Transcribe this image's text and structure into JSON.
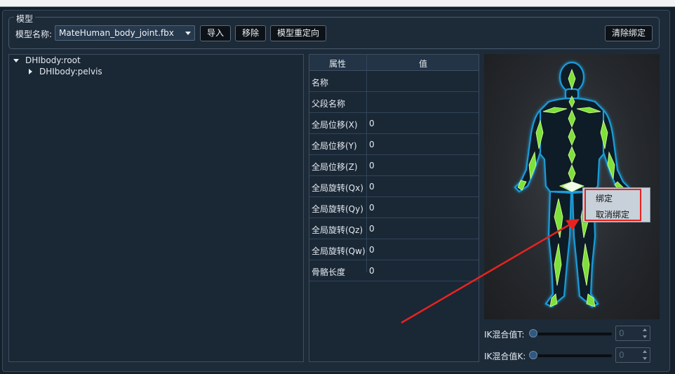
{
  "model_group": {
    "title": "模型",
    "name_label": "模型名称:",
    "selected_model": "MateHuman_body_joint.fbx",
    "buttons": {
      "import": "导入",
      "remove": "移除",
      "retarget": "模型重定向",
      "clear_binding": "清除绑定"
    }
  },
  "tree": {
    "items": [
      {
        "label": "DHIbody:root",
        "expanded": true
      },
      {
        "label": "DHIbody:pelvis",
        "expanded": false
      }
    ]
  },
  "properties": {
    "headers": {
      "property": "属性",
      "value": "值"
    },
    "rows": [
      {
        "key": "名称",
        "value": ""
      },
      {
        "key": "父段名称",
        "value": ""
      },
      {
        "key": "全局位移(X)",
        "value": "0"
      },
      {
        "key": "全局位移(Y)",
        "value": "0"
      },
      {
        "key": "全局位移(Z)",
        "value": "0"
      },
      {
        "key": "全局旋转(Qx)",
        "value": "0"
      },
      {
        "key": "全局旋转(Qy)",
        "value": "0"
      },
      {
        "key": "全局旋转(Qz)",
        "value": "0"
      },
      {
        "key": "全局旋转(Qw)",
        "value": "0"
      },
      {
        "key": "骨骼长度",
        "value": "0"
      }
    ]
  },
  "context_menu": {
    "items": [
      "绑定",
      "取消绑定"
    ]
  },
  "ik": {
    "t_label": "IK混合值T:",
    "t_value": "0",
    "k_label": "IK混合值K:",
    "k_value": "0",
    "t_level": 0,
    "k_level": 0
  },
  "colors": {
    "panel_bg": "#1d2a38",
    "bone_green": "#7ee03a",
    "body_glow": "#1a9bd8",
    "annotation_red": "#e8231f",
    "context_bg": "#c8d1da"
  }
}
